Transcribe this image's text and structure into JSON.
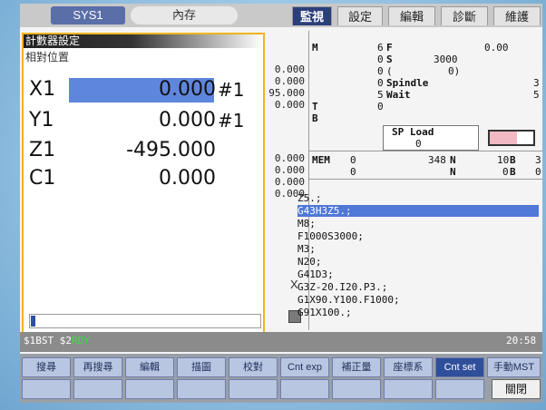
{
  "header": {
    "system_tab": "SYS1",
    "memory_tab": "內存",
    "mode_tabs": [
      {
        "label": "監視",
        "active": true
      },
      {
        "label": "設定",
        "active": false
      },
      {
        "label": "編輯",
        "active": false
      },
      {
        "label": "診斷",
        "active": false
      },
      {
        "label": "維護",
        "active": false
      }
    ]
  },
  "counter": {
    "title": "計數器設定",
    "subtitle": "相對位置",
    "axes": [
      {
        "name": "X1",
        "value": "0.000",
        "suffix": "#1"
      },
      {
        "name": "Y1",
        "value": "0.000",
        "suffix": "#1"
      },
      {
        "name": "Z1",
        "value": "-495.000",
        "suffix": ""
      },
      {
        "name": "C1",
        "value": "0.000",
        "suffix": ""
      }
    ]
  },
  "middle": {
    "values": [
      "0.000",
      "0.000",
      "95.000",
      "0.000",
      "0.000",
      "0.000",
      "0.000",
      "0.000"
    ],
    "x_label": "X"
  },
  "right": {
    "col_letters": [
      "M",
      "T",
      "B"
    ],
    "count_col": [
      "6",
      "0",
      "0",
      "0",
      "5",
      "0"
    ],
    "f_label": "F",
    "f_value": "0.00",
    "s_label": "S",
    "s_value": "3000",
    "paren_open": "(",
    "paren_value": "0)",
    "spindle_label": "Spindle",
    "spindle_value": "3",
    "wait_label": "Wait",
    "wait_value": "5",
    "spload_label": "SP Load",
    "spload_value": "0",
    "mem_label": "MEM",
    "mem_c1": "0",
    "mem_c2": "0",
    "n1_value": "348",
    "n_label": "N",
    "b1_value": "10",
    "b_label": "B",
    "tail1": "3",
    "tail2": "0",
    "b2_value": "0",
    "program": [
      "Z5.;",
      "G43H3Z5.;",
      "M8;",
      "F1000S3000;",
      "M3;",
      "N20;",
      "G41D3;",
      "G3Z-20.I20.P3.;",
      "G1X90.Y100.F1000;",
      "G91X100.;"
    ]
  },
  "status": {
    "left": "$1BST  $2",
    "rdy": "RDY",
    "time": "20:58"
  },
  "softkeys": [
    {
      "label": "搜尋",
      "lit": false
    },
    {
      "label": "再搜尋",
      "lit": false
    },
    {
      "label": "編輯",
      "lit": false
    },
    {
      "label": "描圖",
      "lit": false
    },
    {
      "label": "校對",
      "lit": false
    },
    {
      "label": "Cnt exp",
      "lit": false
    },
    {
      "label": "補正量",
      "lit": false
    },
    {
      "label": "座標系",
      "lit": false
    },
    {
      "label": "Cnt set",
      "lit": true
    },
    {
      "label": "手動MST",
      "lit": false
    }
  ],
  "close_label": "關閉"
}
